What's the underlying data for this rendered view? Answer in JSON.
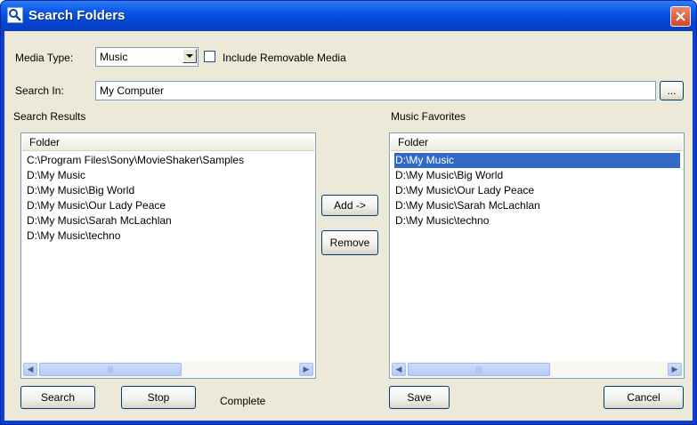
{
  "window": {
    "title": "Search Folders"
  },
  "media_type": {
    "label": "Media Type:",
    "selected": "Music",
    "include_removable_label": "Include Removable Media",
    "include_removable_checked": false
  },
  "search_in": {
    "label": "Search In:",
    "value": "My Computer",
    "browse_label": "..."
  },
  "results": {
    "label": "Search Results",
    "column": "Folder",
    "items": [
      "C:\\Program Files\\Sony\\MovieShaker\\Samples",
      "D:\\My Music",
      "D:\\My Music\\Big World",
      "D:\\My Music\\Our Lady Peace",
      "D:\\My Music\\Sarah McLachlan",
      "D:\\My Music\\techno"
    ]
  },
  "favorites": {
    "label": "Music Favorites",
    "column": "Folder",
    "items": [
      "D:\\My Music",
      "D:\\My Music\\Big World",
      "D:\\My Music\\Our Lady Peace",
      "D:\\My Music\\Sarah McLachlan",
      "D:\\My Music\\techno"
    ],
    "selected_index": 0
  },
  "buttons": {
    "add": "Add ->",
    "remove": "Remove",
    "search": "Search",
    "stop": "Stop",
    "save": "Save",
    "cancel": "Cancel"
  },
  "status": "Complete",
  "icons": {
    "title": "search-folder-icon",
    "close": "close-icon",
    "dropdown": "chevron-down-icon"
  },
  "colors": {
    "titlebar": "#0a58e6",
    "face": "#ece9d8",
    "selection": "#316ac5",
    "close": "#d2452a"
  }
}
